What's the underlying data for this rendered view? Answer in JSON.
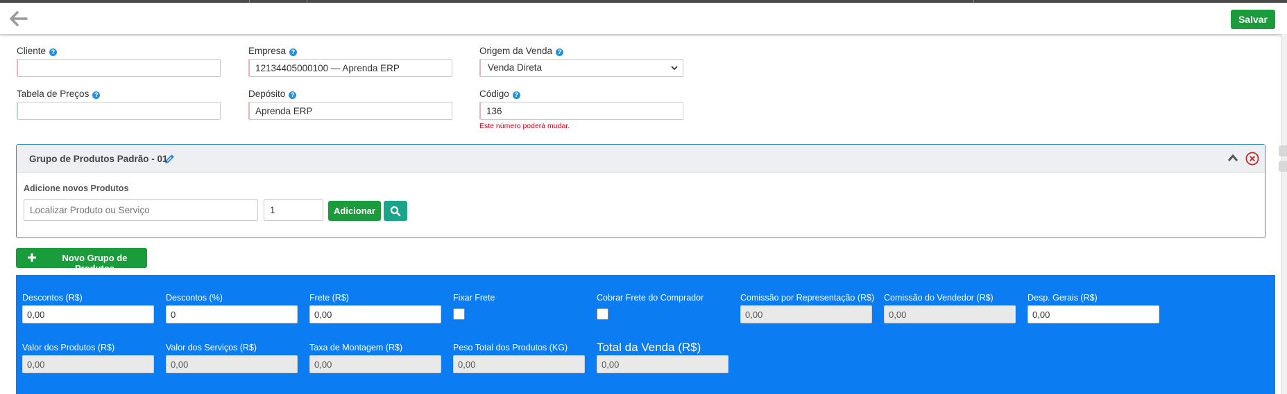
{
  "header": {
    "save_label": "Salvar"
  },
  "form": {
    "cliente": {
      "label": "Cliente",
      "value": ""
    },
    "empresa": {
      "label": "Empresa",
      "value": "12134405000100 — Aprenda ERP"
    },
    "origem": {
      "label": "Origem da Venda",
      "value": "Venda Direta"
    },
    "tabela": {
      "label": "Tabela de Preços",
      "value": ""
    },
    "deposito": {
      "label": "Depósito",
      "value": "Aprenda ERP"
    },
    "codigo": {
      "label": "Código",
      "value": "136",
      "hint": "Este número poderá mudar."
    }
  },
  "group": {
    "title": "Grupo de Produtos Padrão - 01",
    "add_title": "Adicione novos Produtos",
    "search_placeholder": "Localizar Produto ou Serviço",
    "quantity": "1",
    "add_label": "Adicionar"
  },
  "new_group_label": "Novo Grupo de Produtos",
  "totals": {
    "descontos_rs": {
      "label": "Descontos (R$)",
      "value": "0,00"
    },
    "descontos_pct": {
      "label": "Descontos (%)",
      "value": "0"
    },
    "frete": {
      "label": "Frete (R$)",
      "value": "0,00"
    },
    "fixar_frete": {
      "label": "Fixar Frete"
    },
    "cobrar_frete": {
      "label": "Cobrar Frete do Comprador"
    },
    "comissao_rep": {
      "label": "Comissão por Representação (R$)",
      "value": "0,00"
    },
    "comissao_vend": {
      "label": "Comissão do Vendedor (R$)",
      "value": "0,00"
    },
    "desp_gerais": {
      "label": "Desp. Gerais (R$)",
      "value": "0,00"
    },
    "valor_produtos": {
      "label": "Valor dos Produtos (R$)",
      "value": "0,00"
    },
    "valor_servicos": {
      "label": "Valor dos Serviços (R$)",
      "value": "0,00"
    },
    "taxa_montagem": {
      "label": "Taxa de Montagem (R$)",
      "value": "0,00"
    },
    "peso_total": {
      "label": "Peso Total dos Produtos (KG)",
      "value": "0,00"
    },
    "total_venda": {
      "label": "Total da Venda (R$)",
      "value": "0,00"
    }
  },
  "colors": {
    "accent_green": "#1a9b3c",
    "panel_blue": "#0b7cf2",
    "teal": "#1aa58a",
    "help_blue": "#2a8fd6",
    "hint_red": "#d0021b"
  },
  "icons": [
    "back-arrow-icon",
    "help-icon",
    "chevron-down-icon",
    "pencil-icon",
    "chevron-up-icon",
    "close-circle-icon",
    "search-icon",
    "plus-icon"
  ]
}
